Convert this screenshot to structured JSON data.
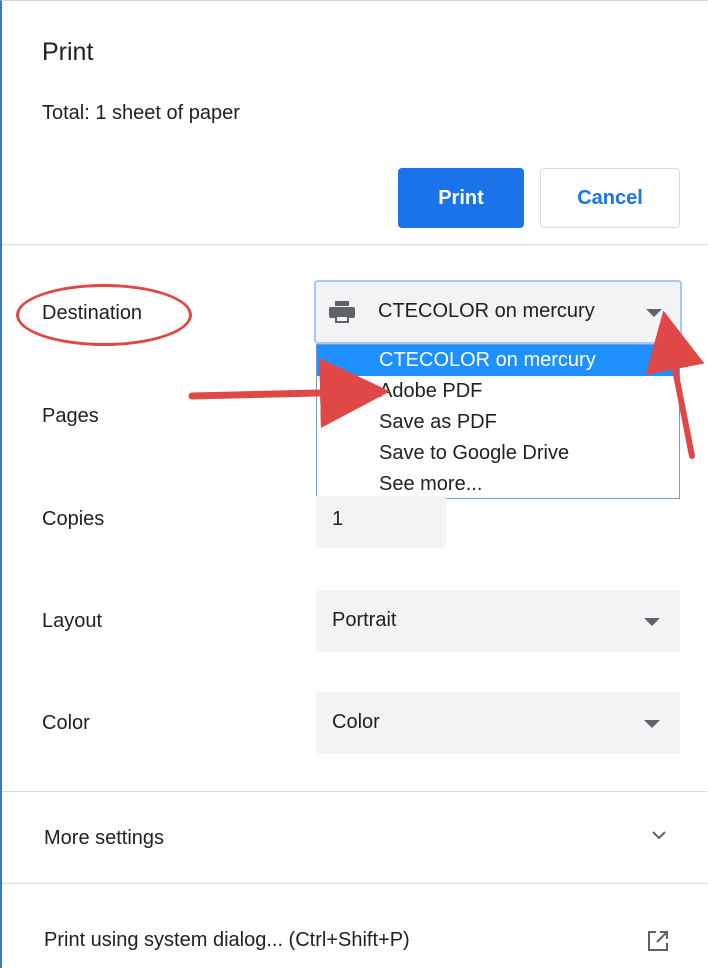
{
  "dialog": {
    "title": "Print",
    "total": "Total: 1 sheet of paper",
    "print_label": "Print",
    "cancel_label": "Cancel"
  },
  "destination": {
    "label": "Destination",
    "selected": "CTECOLOR on mercury",
    "options": [
      "CTECOLOR on mercury",
      "Adobe PDF",
      "Save as PDF",
      "Save to Google Drive",
      "See more..."
    ]
  },
  "pages": {
    "label": "Pages"
  },
  "copies": {
    "label": "Copies",
    "value": "1"
  },
  "layout": {
    "label": "Layout",
    "value": "Portrait"
  },
  "color": {
    "label": "Color",
    "value": "Color"
  },
  "more_settings": {
    "label": "More settings",
    "icon": "chevron-down-icon"
  },
  "system_dialog": {
    "label": "Print using system dialog... (Ctrl+Shift+P)",
    "icon": "open-in-new-icon"
  },
  "colors": {
    "accent": "#1a73e8",
    "annotation": "#e04848",
    "highlight": "#1e90ff"
  }
}
